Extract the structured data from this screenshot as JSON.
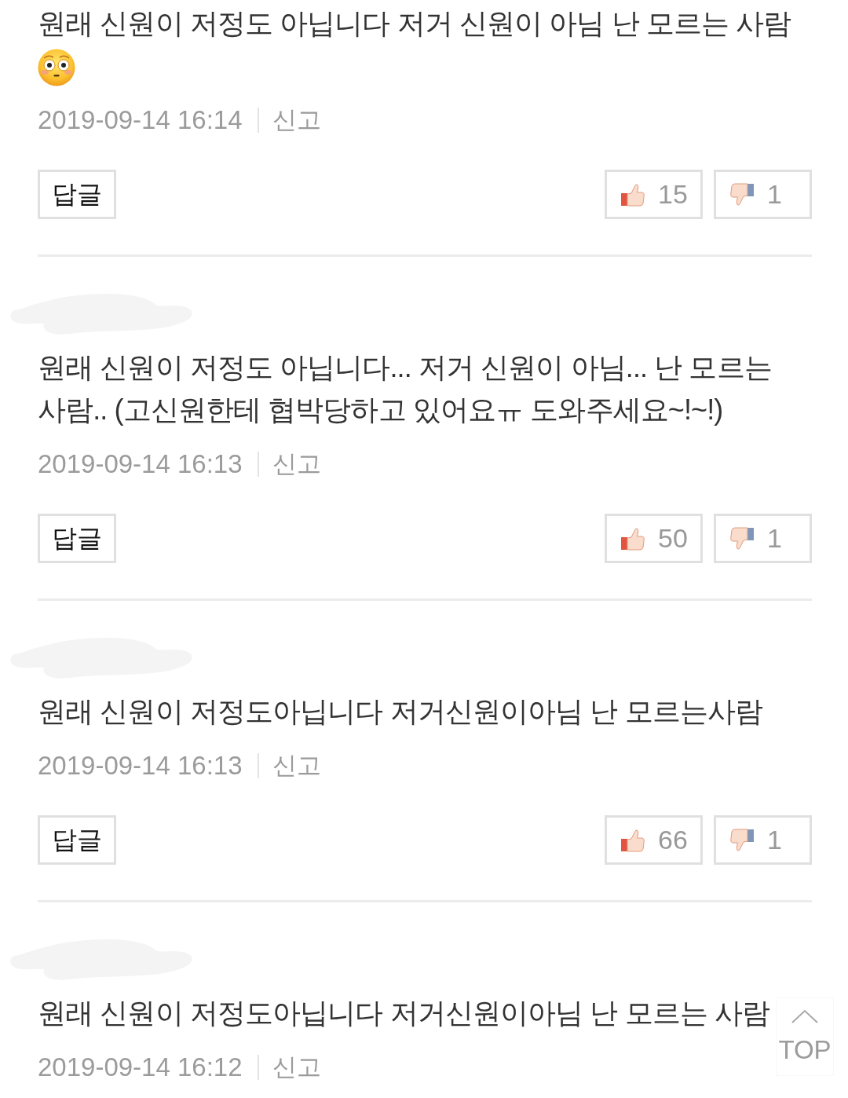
{
  "comments": [
    {
      "author_hidden": false,
      "text": "원래 신원이 저정도 아닙니다 저거 신원이 아님 난 모르는 사람",
      "emoji": true,
      "date": "2019-09-14 16:14",
      "report": "신고",
      "reply": "답글",
      "likes": "15",
      "dislikes": "1"
    },
    {
      "author_hidden": true,
      "text": "원래 신원이 저정도 아닙니다... 저거 신원이 아님... 난 모르는 사람.. (고신원한테 협박당하고 있어요ㅠ 도와주세요~!~!)",
      "emoji": false,
      "date": "2019-09-14 16:13",
      "report": "신고",
      "reply": "답글",
      "likes": "50",
      "dislikes": "1"
    },
    {
      "author_hidden": true,
      "text": "원래 신원이 저정도아닙니다 저거신원이아님 난 모르는사람",
      "emoji": false,
      "date": "2019-09-14 16:13",
      "report": "신고",
      "reply": "답글",
      "likes": "66",
      "dislikes": "1"
    },
    {
      "author_hidden": true,
      "text": "원래 신원이 저정도아닙니다 저거신원이아님 난 모르는 사람",
      "emoji": false,
      "date": "2019-09-14 16:12",
      "report": "신고"
    }
  ],
  "top_button": {
    "label": "TOP"
  }
}
